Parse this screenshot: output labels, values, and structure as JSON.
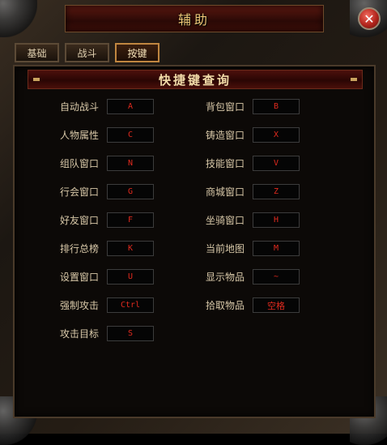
{
  "window": {
    "title": "辅助",
    "close_label": "✕"
  },
  "tabs": [
    {
      "label": "基础",
      "active": false
    },
    {
      "label": "战斗",
      "active": false
    },
    {
      "label": "按键",
      "active": true
    }
  ],
  "panel": {
    "header_title": "快捷键查询"
  },
  "shortcuts": {
    "left": [
      {
        "action": "自动战斗",
        "key": "A"
      },
      {
        "action": "人物属性",
        "key": "C"
      },
      {
        "action": "组队窗口",
        "key": "N"
      },
      {
        "action": "行会窗口",
        "key": "G"
      },
      {
        "action": "好友窗口",
        "key": "F"
      },
      {
        "action": "排行总榜",
        "key": "K"
      },
      {
        "action": "设置窗口",
        "key": "U"
      },
      {
        "action": "强制攻击",
        "key": "Ctrl"
      },
      {
        "action": "攻击目标",
        "key": "S"
      }
    ],
    "right": [
      {
        "action": "背包窗口",
        "key": "B"
      },
      {
        "action": "铸造窗口",
        "key": "X"
      },
      {
        "action": "技能窗口",
        "key": "V"
      },
      {
        "action": "商城窗口",
        "key": "Z"
      },
      {
        "action": "坐骑窗口",
        "key": "H"
      },
      {
        "action": "当前地图",
        "key": "M"
      },
      {
        "action": "显示物品",
        "key": "~"
      },
      {
        "action": "拾取物品",
        "key": "空格"
      }
    ]
  },
  "colors": {
    "key_text": "#e02a1e",
    "label_text": "#d8c8a8",
    "title_text": "#f0c878"
  }
}
